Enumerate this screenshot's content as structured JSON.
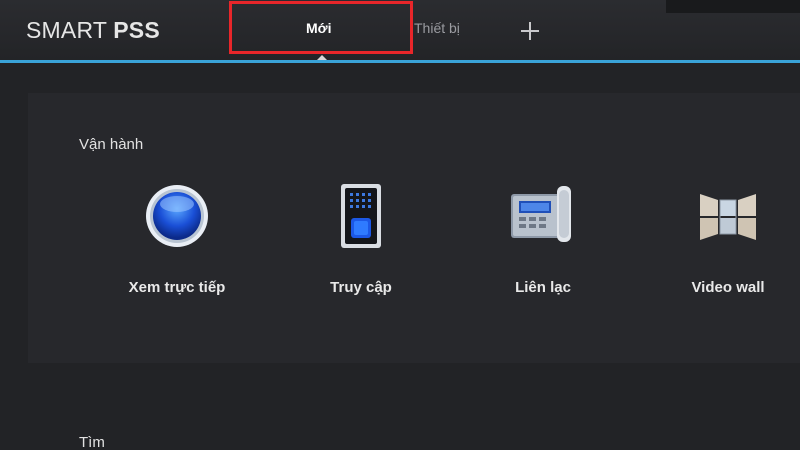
{
  "app": {
    "brand_light": "SMART ",
    "brand_bold": "PSS"
  },
  "tabs": [
    {
      "label": "Mới",
      "active": true
    },
    {
      "label": "Thiết bị",
      "active": false
    }
  ],
  "add_tab_icon": "plus-icon",
  "highlight": {
    "color": "#e8262a",
    "target": "Mới"
  },
  "accent_color": "#3aa3d8",
  "sections": [
    {
      "title": "Vận hành",
      "items": [
        {
          "label": "Xem trực tiếp",
          "icon": "live-view-icon"
        },
        {
          "label": "Truy cập",
          "icon": "access-control-icon"
        },
        {
          "label": "Liên lạc",
          "icon": "intercom-icon"
        },
        {
          "label": "Video wall",
          "icon": "video-wall-icon"
        }
      ]
    },
    {
      "title": "Tìm",
      "items": []
    }
  ]
}
